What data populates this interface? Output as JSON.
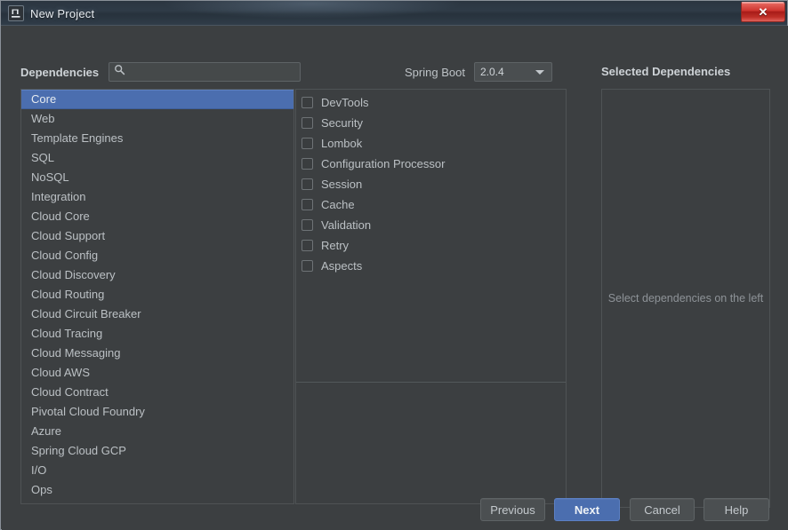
{
  "window": {
    "title": "New Project",
    "app_icon": "intellij-idea-icon",
    "close_label": "✕"
  },
  "toolbar": {
    "dependencies_label": "Dependencies",
    "search": {
      "icon": "search-icon",
      "value": "",
      "placeholder": ""
    },
    "spring_boot_label": "Spring Boot",
    "spring_boot_version": "2.0.4",
    "selected_dependencies_label": "Selected Dependencies"
  },
  "categories": {
    "selected": "Core",
    "items": [
      {
        "label": "Core",
        "selected": true
      },
      {
        "label": "Web",
        "selected": false
      },
      {
        "label": "Template Engines",
        "selected": false
      },
      {
        "label": "SQL",
        "selected": false
      },
      {
        "label": "NoSQL",
        "selected": false
      },
      {
        "label": "Integration",
        "selected": false
      },
      {
        "label": "Cloud Core",
        "selected": false
      },
      {
        "label": "Cloud Support",
        "selected": false
      },
      {
        "label": "Cloud Config",
        "selected": false
      },
      {
        "label": "Cloud Discovery",
        "selected": false
      },
      {
        "label": "Cloud Routing",
        "selected": false
      },
      {
        "label": "Cloud Circuit Breaker",
        "selected": false
      },
      {
        "label": "Cloud Tracing",
        "selected": false
      },
      {
        "label": "Cloud Messaging",
        "selected": false
      },
      {
        "label": "Cloud AWS",
        "selected": false
      },
      {
        "label": "Cloud Contract",
        "selected": false
      },
      {
        "label": "Pivotal Cloud Foundry",
        "selected": false
      },
      {
        "label": "Azure",
        "selected": false
      },
      {
        "label": "Spring Cloud GCP",
        "selected": false
      },
      {
        "label": "I/O",
        "selected": false
      },
      {
        "label": "Ops",
        "selected": false
      }
    ]
  },
  "dependencies": {
    "items": [
      {
        "label": "DevTools",
        "checked": false
      },
      {
        "label": "Security",
        "checked": false
      },
      {
        "label": "Lombok",
        "checked": false
      },
      {
        "label": "Configuration Processor",
        "checked": false
      },
      {
        "label": "Session",
        "checked": false
      },
      {
        "label": "Cache",
        "checked": false
      },
      {
        "label": "Validation",
        "checked": false
      },
      {
        "label": "Retry",
        "checked": false
      },
      {
        "label": "Aspects",
        "checked": false
      }
    ]
  },
  "selected_panel": {
    "placeholder": "Select dependencies on the left",
    "items": []
  },
  "buttons": {
    "previous": "Previous",
    "next": "Next",
    "cancel": "Cancel",
    "help": "Help",
    "default_button": "Next"
  },
  "colors": {
    "dialog_bg": "#3c3f41",
    "selection_blue": "#4b6eaf",
    "text": "#bbc0c4",
    "title_bar": "#2f3b47",
    "close_red": "#cf3730"
  }
}
